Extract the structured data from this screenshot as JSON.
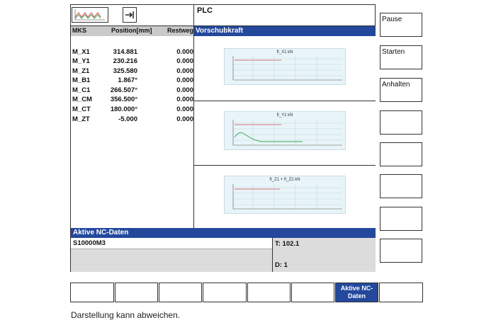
{
  "header": {
    "plc_label": "PLC"
  },
  "table": {
    "columns": [
      "MKS",
      "Position[mm]",
      "Restweg"
    ],
    "rows": [
      {
        "axis": "M_X1",
        "position": "314.881",
        "rest": "0.000"
      },
      {
        "axis": "M_Y1",
        "position": "230.216",
        "rest": "0.000"
      },
      {
        "axis": "M_Z1",
        "position": "325.580",
        "rest": "0.000"
      },
      {
        "axis": "M_B1",
        "position": "1.867°",
        "rest": "0.000"
      },
      {
        "axis": "M_C1",
        "position": "266.507°",
        "rest": "0.000"
      },
      {
        "axis": "M_CM",
        "position": "356.500°",
        "rest": "0.000"
      },
      {
        "axis": "M_CT",
        "position": "180.000°",
        "rest": "0.000"
      },
      {
        "axis": "M_ZT",
        "position": "-5.000",
        "rest": "0.000"
      }
    ]
  },
  "feed_panel": {
    "title": "Vorschubkraft",
    "charts": [
      {
        "title": "ft_X1 kN"
      },
      {
        "title": "ft_Y1 kN"
      },
      {
        "title": "ft_Z1 + ft_Z2 kN"
      }
    ]
  },
  "nc_data": {
    "title": "Aktive NC-Daten",
    "program": "S10000M3",
    "tool": "T: 102.1",
    "d_value": "D: 1"
  },
  "softkeys_right": [
    "Pause",
    "Starten",
    "Anhalten",
    "",
    "",
    "",
    "",
    ""
  ],
  "softkeys_bottom": [
    "",
    "",
    "",
    "",
    "",
    "",
    "Aktive NC-Daten",
    ""
  ],
  "footer": {
    "note": "Darstellung kann abweichen."
  },
  "colors": {
    "header_blue": "#23489c",
    "chart_bg": "#e8f4f8",
    "red_line": "#d24b4b",
    "green_line": "#3aa655"
  }
}
